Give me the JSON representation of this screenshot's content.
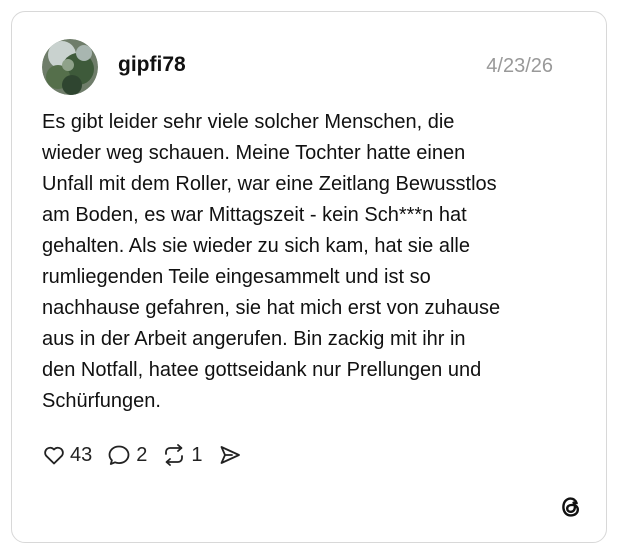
{
  "post": {
    "username": "gipfi78",
    "date": "4/23/26",
    "text": "Es gibt leider sehr viele solcher Menschen, die\nwieder weg schauen. Meine Tochter hatte einen\nUnfall mit dem Roller, war eine Zeitlang Bewusstlos\nam Boden, es war Mittagszeit - kein Sch***n hat\ngehalten. Als sie wieder zu sich kam, hat sie alle\nrumliegenden Teile eingesammelt und ist so\nnachhause gefahren, sie hat mich erst von zuhause\naus in der Arbeit angerufen. Bin zackig mit ihr in\nden Notfall, hatee gottseidank nur Prellungen und\nSchürfungen."
  },
  "actions": {
    "likes": "43",
    "replies": "2",
    "reposts": "1"
  },
  "icons": {
    "like": "heart-icon",
    "reply": "speech-bubble-icon",
    "repost": "repost-icon",
    "share": "send-icon",
    "brand": "threads-logo-icon"
  }
}
